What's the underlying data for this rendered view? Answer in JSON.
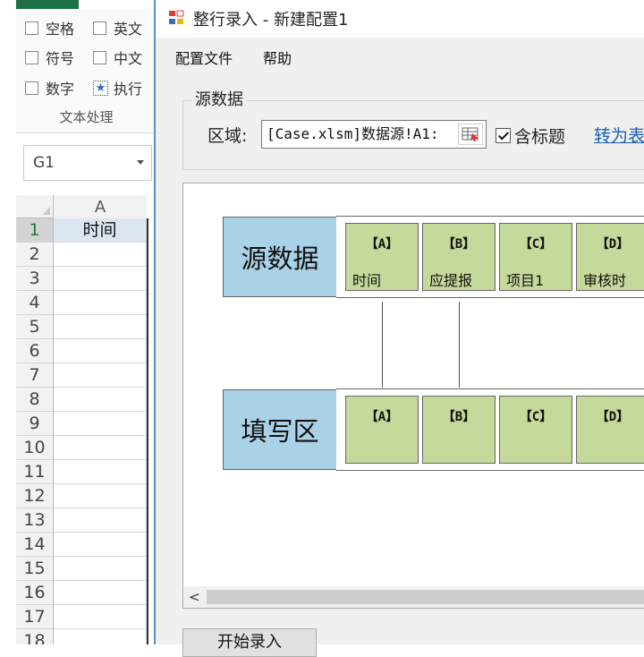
{
  "excel": {
    "checkboxes": [
      {
        "label": "空格",
        "checked": false
      },
      {
        "label": "英文",
        "checked": false
      },
      {
        "label": "符号",
        "checked": false
      },
      {
        "label": "中文",
        "checked": false
      },
      {
        "label": "数字",
        "checked": false
      }
    ],
    "execute_label": "执行",
    "group_label": "文本处理",
    "name_box": "G1",
    "column_header": "A",
    "row_numbers": [
      "1",
      "2",
      "3",
      "4",
      "5",
      "6",
      "7",
      "8",
      "9",
      "10",
      "11",
      "12",
      "13",
      "14",
      "15",
      "16",
      "17",
      "18"
    ],
    "cell_a1": "时间"
  },
  "dialog": {
    "title": "整行录入 - 新建配置1",
    "menu": [
      "配置文件",
      "帮助"
    ],
    "source_group_label": "源数据",
    "area_label": "区域:",
    "area_value": "[Case.xlsm]数据源!A1:",
    "has_header_label": "含标题",
    "has_header_checked": true,
    "convert_link": "转为表",
    "source_row_label": "源数据",
    "target_row_label": "填写区",
    "source_columns": [
      {
        "letter": "【A】",
        "name": "时间"
      },
      {
        "letter": "【B】",
        "name": "应提报"
      },
      {
        "letter": "【C】",
        "name": "项目1"
      },
      {
        "letter": "【D】",
        "name": "审核时"
      }
    ],
    "target_columns": [
      {
        "letter": "【A】"
      },
      {
        "letter": "【B】"
      },
      {
        "letter": "【C】"
      },
      {
        "letter": "【D】"
      }
    ],
    "start_button": "开始录入",
    "colors": {
      "label_bg": "#a9d2e6",
      "column_bg": "#c5d99a",
      "link": "#1a5fb4",
      "excel_green": "#1e7145"
    }
  }
}
